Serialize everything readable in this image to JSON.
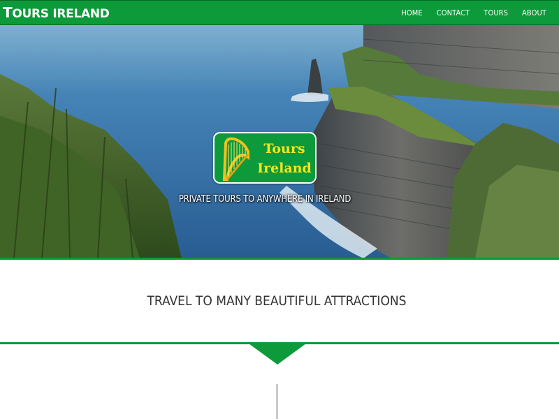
{
  "navbar": {
    "brand_cap": "T",
    "brand_rest": "OURS IRELAND",
    "links": [
      "HOME",
      "CONTACT",
      "TOURS",
      "ABOUT"
    ]
  },
  "hero": {
    "logo_line1": "Tours",
    "logo_line2": "Ireland",
    "tagline": "PRIVATE TOURS TO ANYWHERE IN IRELAND"
  },
  "section": {
    "heading": "TRAVEL TO MANY BEAUTIFUL ATTRACTIONS"
  },
  "colors": {
    "brand_green": "#0c9a3a",
    "logo_yellow": "#f7e41c",
    "heading_text": "#333333"
  },
  "icons": {
    "logo": "harp-icon",
    "divider": "chevron-down-icon"
  }
}
